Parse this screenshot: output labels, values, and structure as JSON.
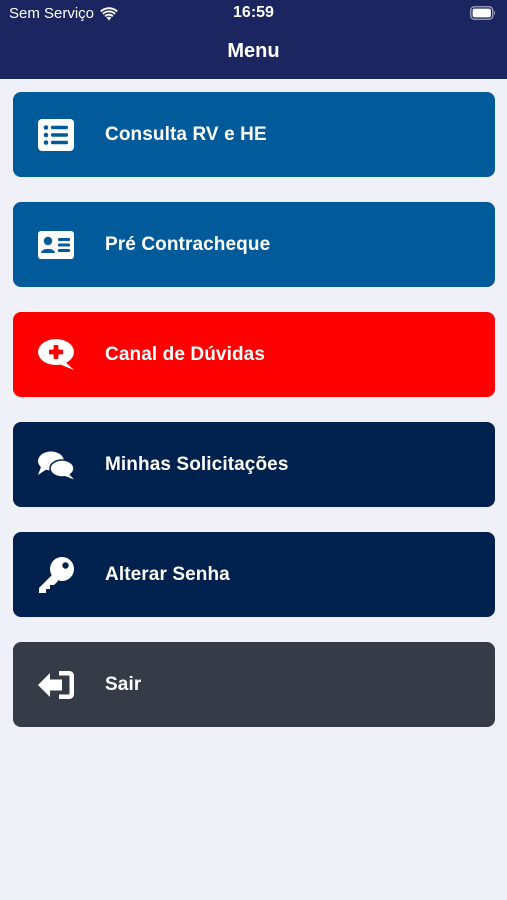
{
  "status_bar": {
    "carrier": "Sem Serviço",
    "time": "16:59",
    "wifi_icon": "wifi-icon",
    "battery_icon": "battery-icon"
  },
  "header": {
    "title": "Menu",
    "background": "#1b2661"
  },
  "menu": {
    "items": [
      {
        "label": "Consulta RV e HE",
        "icon": "list-icon",
        "color": "#015a9a"
      },
      {
        "label": "Pré Contracheque",
        "icon": "id-card-icon",
        "color": "#015a9a"
      },
      {
        "label": "Canal de Dúvidas",
        "icon": "medical-chat-icon",
        "color": "#fe0000"
      },
      {
        "label": "Minhas Solicitações",
        "icon": "comments-icon",
        "color": "#00204d"
      },
      {
        "label": "Alterar Senha",
        "icon": "key-icon",
        "color": "#00204d"
      },
      {
        "label": "Sair",
        "icon": "sign-out-icon",
        "color": "#353c48"
      }
    ]
  },
  "page_background": "#eff0f8"
}
